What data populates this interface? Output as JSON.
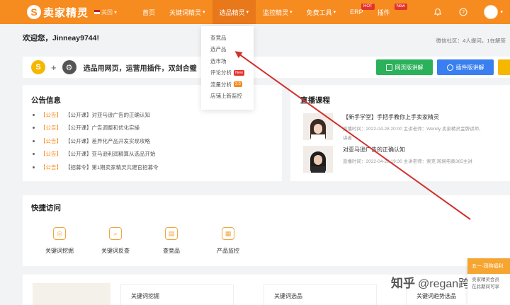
{
  "header": {
    "logo_mark": "S",
    "logo_text": "卖家精灵",
    "region": "美国",
    "nav": [
      {
        "label": "首页"
      },
      {
        "label": "关键词精灵"
      },
      {
        "label": "选品精灵"
      },
      {
        "label": "监控精灵"
      },
      {
        "label": "免费工具"
      },
      {
        "label": "ERP",
        "badge": "HOT"
      },
      {
        "label": "插件",
        "badge": "New"
      }
    ]
  },
  "dropdown": {
    "items": [
      {
        "label": "查竞品"
      },
      {
        "label": "选产品"
      },
      {
        "label": "选市场"
      },
      {
        "label": "评论分析",
        "badge": "New"
      },
      {
        "label": "流量分析",
        "badge": "2.0"
      },
      {
        "label": "店铺上新监控"
      }
    ]
  },
  "welcome": "欢迎您，Jinneay9744!",
  "community": "微信社区：4人提问，1在解答",
  "banner": {
    "text": "选品用网页，运营用插件，双剑合璧",
    "btn_green": "网页版讲解",
    "btn_blue": "插件版讲解"
  },
  "announcements": {
    "title": "公告信息",
    "items": [
      {
        "tag": "【公告】",
        "text": "【公开课】对亚马逊广告的正确认知"
      },
      {
        "tag": "【公告】",
        "text": "【公开课】广告调整和优化实操"
      },
      {
        "tag": "【公告】",
        "text": "【公开课】差异化产品开发实现攻略"
      },
      {
        "tag": "【公告】",
        "text": "【公开课】亚马逊利润精算从选品开始"
      },
      {
        "tag": "【公告】",
        "text": "【招募令】第1期卖家精灵共建官招募令"
      }
    ]
  },
  "live": {
    "title": "直播课程",
    "courses": [
      {
        "title": "【新手学堂】手把手教你上手卖家精灵",
        "meta": "直播时间：2022-04-28 20:00   主讲老师：Wendy  卖家精灵金牌讲师、",
        "meta2": "讲者"
      },
      {
        "title": "对亚马逊广告的正确认知",
        "meta": "直播时间：2022-04-28 19:30   主讲老师：索克  跨境电商365主讲"
      }
    ]
  },
  "quick": {
    "title": "快捷访问",
    "items": [
      {
        "label": "关键词挖掘",
        "icon": "keyword-mining-icon"
      },
      {
        "label": "关键词反查",
        "icon": "keyword-reverse-icon"
      },
      {
        "label": "查竞品",
        "icon": "competitor-icon"
      },
      {
        "label": "产品监控",
        "icon": "monitor-icon"
      }
    ]
  },
  "bottom": {
    "cards": [
      {
        "label": "关键词挖掘"
      },
      {
        "label": "关键词选品"
      },
      {
        "label": "关键词趋势选品"
      }
    ]
  },
  "watermark": {
    "text": "知乎",
    "author": "@regan跨境"
  },
  "side_popup": {
    "head": "五一·团购福利",
    "lines": [
      "卖家精灵会员",
      "在此期间可享"
    ]
  },
  "colors": {
    "brand": "#f68b1f",
    "green": "#2bb15a",
    "blue": "#3a7ff0",
    "arrow": "#d0312d"
  }
}
